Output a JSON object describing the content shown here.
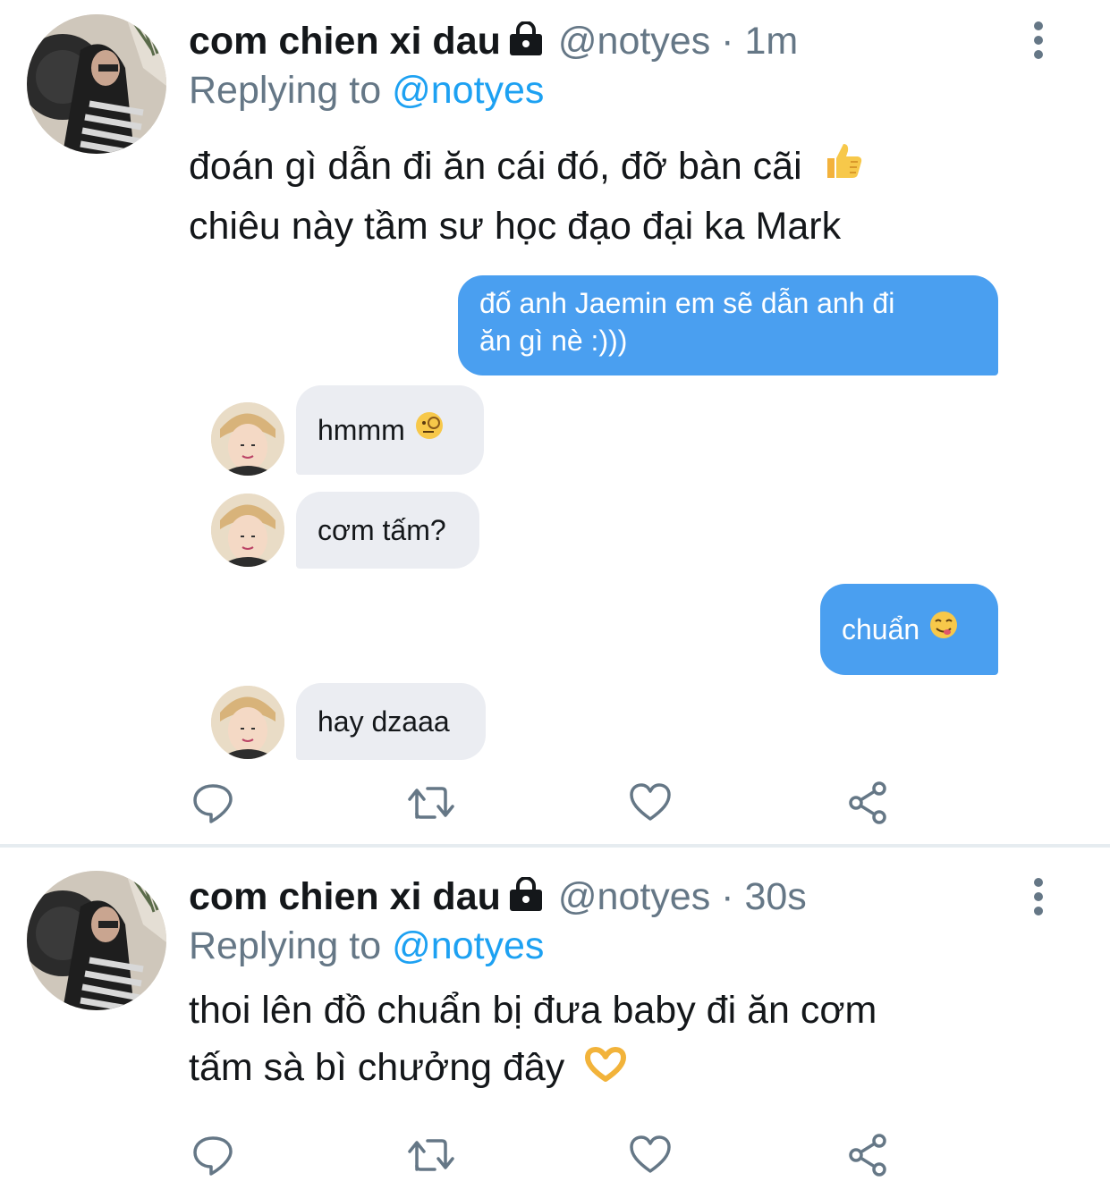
{
  "colors": {
    "link": "#1da1f2",
    "secondary_text": "#657786",
    "outgoing_bubble": "#4a9ff0",
    "incoming_bubble": "#ebedf2",
    "divider": "#e6ecf0"
  },
  "tweets": [
    {
      "display_name": "com chien xi dau",
      "protected_icon": "lock-icon",
      "handle": "@notyes",
      "separator": "·",
      "time": "1m",
      "replying_prefix": "Replying to",
      "replying_handle": "@notyes",
      "text_lines": [
        "đoán gì dẫn đi ăn cái đó, đỡ bàn cãi",
        "chiêu này tầm sư học đạo đại ka Mark"
      ],
      "text_emoji": "thumbs-up-emoji",
      "chat": [
        {
          "side": "outgoing",
          "lines": [
            "đố anh Jaemin em sẽ dẫn anh đi",
            "ăn gì nè :)))"
          ]
        },
        {
          "side": "incoming",
          "text": "hmmm",
          "emoji": "face-with-monocle-emoji"
        },
        {
          "side": "incoming",
          "text": "cơm tấm?"
        },
        {
          "side": "outgoing",
          "text": "chuẩn",
          "emoji": "face-savoring-food-emoji"
        },
        {
          "side": "incoming",
          "text": "hay dzaaa"
        }
      ],
      "actions": [
        "reply-icon",
        "retweet-icon",
        "like-icon",
        "share-icon"
      ]
    },
    {
      "display_name": "com chien xi dau",
      "protected_icon": "lock-icon",
      "handle": "@notyes",
      "separator": "·",
      "time": "30s",
      "replying_prefix": "Replying to",
      "replying_handle": "@notyes",
      "text_lines": [
        "thoi lên đồ chuẩn bị đưa baby đi ăn cơm",
        "tấm sà  bì chưởng đây"
      ],
      "text_emoji": "heart-hands-emoji",
      "actions": [
        "reply-icon",
        "retweet-icon",
        "like-icon",
        "share-icon"
      ]
    }
  ]
}
